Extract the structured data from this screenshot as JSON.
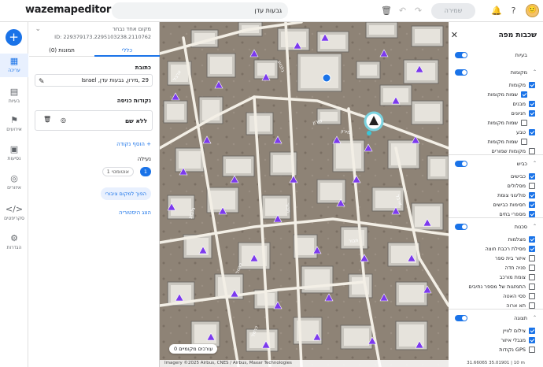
{
  "topbar": {
    "logo": "wazemapeditor",
    "search_value": "גבעות עדן",
    "save_label": "שמירה",
    "avatar": "🙂"
  },
  "leftnav": {
    "items": [
      {
        "icon": "▦",
        "label": "עריכה"
      },
      {
        "icon": "▤",
        "label": "בעיות"
      },
      {
        "icon": "⚑",
        "label": "אירועים"
      },
      {
        "icon": "▣",
        "label": "נסיעות"
      },
      {
        "icon": "◎",
        "label": "איזורים"
      },
      {
        "icon": "</>",
        "label": "סקריפטים"
      },
      {
        "icon": "⚙",
        "label": "הגדרות"
      }
    ]
  },
  "panel": {
    "title": "מקום אחד נבחר",
    "id": "ID: 229379173.2295103238.2110762",
    "tabs": [
      "כללי",
      "תמונות (0)"
    ],
    "address_label": "כתובת",
    "address_value": "29 ,מירון, גבעות עדן, Israel",
    "entry_label": "נקודות כניסה",
    "entry_name": "ללא שם",
    "add_point": "+ הוסף נקודה",
    "lock_label": "נעילה",
    "lock_pill": "אוטומטי 1",
    "lock_num": "1",
    "convert_btn": "הפוך למקום ציבורי",
    "history_link": "הצג היסטוריה"
  },
  "map": {
    "places_pill": "עורכים מקומיים 0",
    "attribution": "Imagery ©2025 Airbus, CNES / Airbus, Maxar Technologies",
    "street_labels": [
      "מירון",
      "מירון",
      "ארבל",
      "גלבוע",
      "גלבוע",
      "כרמל",
      "תבור",
      "תבור",
      "ארבל",
      "כרמל"
    ]
  },
  "layers": {
    "title": "שכבות מפה",
    "rows": [
      {
        "label": "בעיות",
        "kind": "top",
        "on": true
      },
      {
        "label": "מקומות",
        "kind": "head",
        "on": true
      },
      {
        "label": "מקומות",
        "kind": "item",
        "on": true
      },
      {
        "label": "שמות מקומות",
        "kind": "sub",
        "on": true
      },
      {
        "label": "מבנים",
        "kind": "item",
        "on": true
      },
      {
        "label": "חניונים",
        "kind": "item",
        "on": true
      },
      {
        "label": "שמות מקומות",
        "kind": "sub",
        "on": false
      },
      {
        "label": "טבע",
        "kind": "item",
        "on": true
      },
      {
        "label": "שמות מקומות",
        "kind": "sub",
        "on": false
      },
      {
        "label": "מקומות שמורים",
        "kind": "item",
        "on": false
      },
      {
        "label": "כביש",
        "kind": "head",
        "on": true
      },
      {
        "label": "כבישים",
        "kind": "item",
        "on": true
      },
      {
        "label": "מסלולים",
        "kind": "item",
        "on": false
      },
      {
        "label": "פוליגוני צומת",
        "kind": "item",
        "on": true
      },
      {
        "label": "חסימות כבישים",
        "kind": "item",
        "on": true
      },
      {
        "label": "מספרי בתים",
        "kind": "item",
        "on": true
      },
      {
        "label": "סכנות",
        "kind": "head",
        "on": true
      },
      {
        "label": "מצלמות",
        "kind": "item",
        "on": true
      },
      {
        "label": "מסילת רכבת חוצה",
        "kind": "item",
        "on": true
      },
      {
        "label": "איזור בית ספר",
        "kind": "item",
        "on": false
      },
      {
        "label": "פניה חדה",
        "kind": "item",
        "on": false
      },
      {
        "label": "צומת מורכב",
        "kind": "item",
        "on": false
      },
      {
        "label": "התמזגות של מספר נתיבים",
        "kind": "item",
        "on": false
      },
      {
        "label": "פסי האטה",
        "kind": "item",
        "on": false
      },
      {
        "label": "תא ארוה",
        "kind": "item",
        "on": false
      },
      {
        "label": "תצוגה",
        "kind": "head",
        "on": true
      },
      {
        "label": "צילום לוויין",
        "kind": "item",
        "on": true
      },
      {
        "label": "מגבלי איזור",
        "kind": "item",
        "on": true
      },
      {
        "label": "GPS נקודות",
        "kind": "item",
        "on": false
      }
    ],
    "status": "31.66065 35.01901 | 10 m"
  },
  "colors": {
    "accent": "#1a73e8",
    "place": "#7c3aed",
    "road": "#f5f2ea"
  }
}
